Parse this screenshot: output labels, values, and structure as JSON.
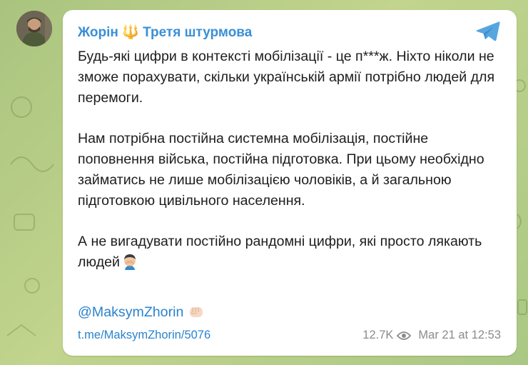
{
  "channel": {
    "name": "Жорін",
    "separator": "🔱",
    "unit": "Третя штурмова"
  },
  "message": {
    "paragraph1": "Будь-які цифри в контексті мобілізації - це п***ж. Ніхто ніколи не зможе порахувати, скільки українській армії потрібно людей для перемоги.",
    "paragraph2": "Нам потрібна постійна системна мобілізація, постійне поповнення війська, постійна підготовка. При цьому необхідно займатись не лише мобілізацією чоловіків, а й загальною підготовкою цивільного населення.",
    "paragraph3": "А не вигадувати постійно рандомні цифри, які просто лякають людей",
    "handle": "@MaksymZhorin",
    "link": "t.me/MaksymZhorin/5076"
  },
  "meta": {
    "views": "12.7K",
    "date": "Mar 21 at 12:53"
  },
  "icons": {
    "facepalm": "facepalm-emoji",
    "fist": "fist-emoji",
    "views": "eye-icon",
    "telegram": "telegram-logo-icon"
  },
  "colors": {
    "accent": "#3a8fd6",
    "link": "#2a83cc",
    "muted": "#8b8b8b",
    "background": "#b7ce8a"
  }
}
